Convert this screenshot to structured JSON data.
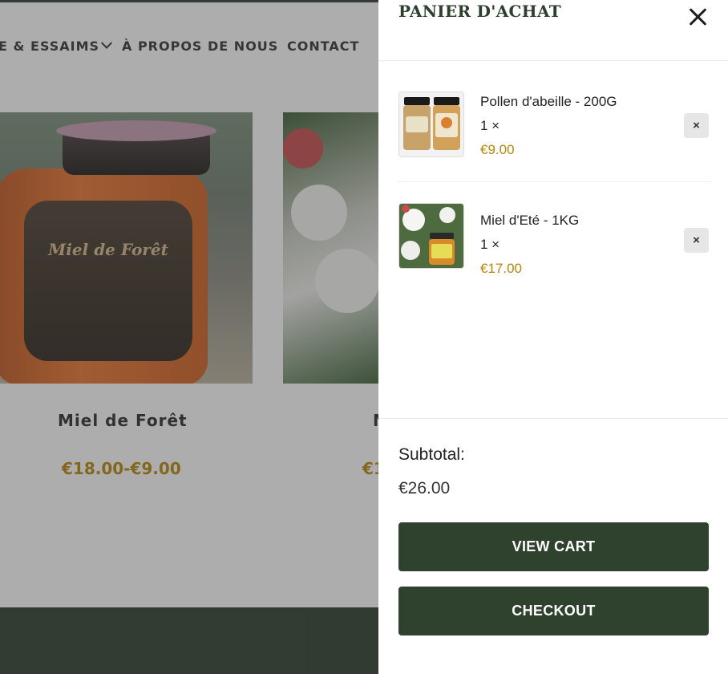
{
  "nav": {
    "items": [
      {
        "label": "E & ESSAIMS",
        "has_dropdown": true
      },
      {
        "label": "À PROPOS DE NOUS",
        "has_dropdown": false
      },
      {
        "label": "CONTACT",
        "has_dropdown": false
      }
    ]
  },
  "products": [
    {
      "name": "Miel de Forêt",
      "price": "€18.00-€9.00",
      "jar_text": "Miel de Forêt"
    },
    {
      "name": "M",
      "price": "€1"
    }
  ],
  "cart": {
    "title": "PANIER D'ACHAT",
    "items": [
      {
        "name": "Pollen d'abeille - 200G",
        "qty": "1 ×",
        "price": "€9.00"
      },
      {
        "name": "Miel d'Eté - 1KG",
        "qty": "1 ×",
        "price": "€17.00"
      }
    ],
    "subtotal_label": "Subtotal:",
    "subtotal_value": "€26.00",
    "view_cart_label": "VIEW CART",
    "checkout_label": "CHECKOUT",
    "remove_symbol": "×"
  },
  "colors": {
    "brand_green": "#2e422d",
    "price_gold": "#b8860b"
  }
}
